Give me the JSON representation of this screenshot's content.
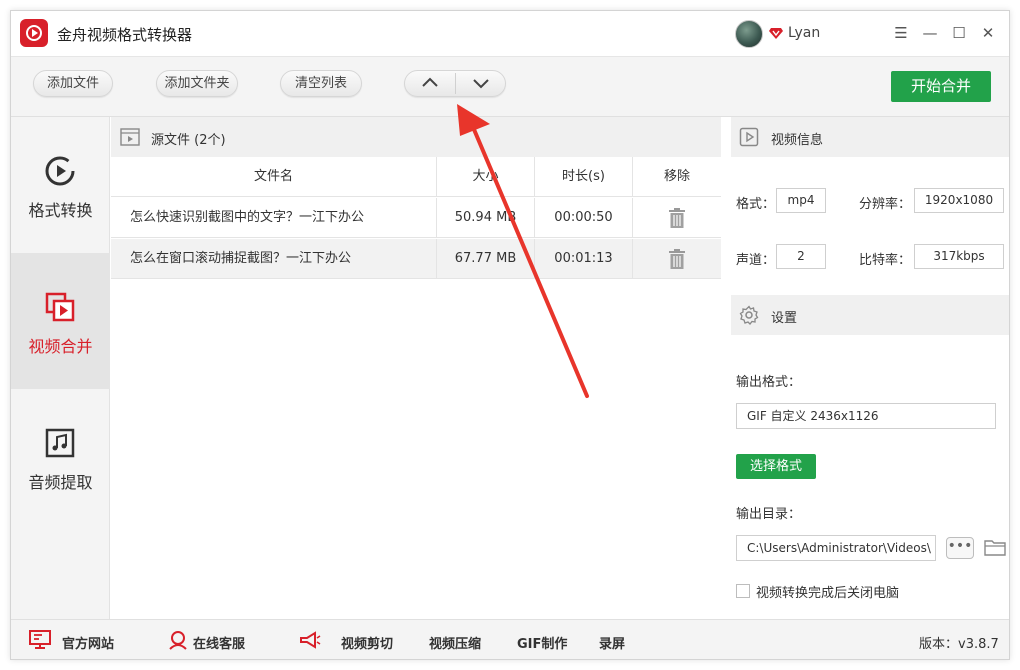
{
  "app": {
    "title": "金舟视频格式转换器"
  },
  "user": {
    "name": "Lyan"
  },
  "window_controls": {
    "menu": "☰",
    "minimize": "—",
    "maximize": "☐",
    "close": "✕"
  },
  "toolbar": {
    "add_file": "添加文件",
    "add_folder": "添加文件夹",
    "clear_list": "清空列表",
    "move_up_icon": "chevron-up-icon",
    "move_down_icon": "chevron-down-icon",
    "start_merge": "开始合并"
  },
  "sidebar": {
    "items": [
      {
        "label": "格式转换",
        "icon": "play-circle-icon",
        "active": false
      },
      {
        "label": "视频合并",
        "icon": "merge-icon",
        "active": true
      },
      {
        "label": "音频提取",
        "icon": "music-note-icon",
        "active": false
      }
    ]
  },
  "file_list": {
    "header": "源文件 (2个)",
    "columns": {
      "name": "文件名",
      "size": "大小",
      "duration": "时长(s)",
      "remove": "移除"
    },
    "rows": [
      {
        "name": "怎么快速识别截图中的文字？一江下办公",
        "size": "50.94 MB",
        "duration": "00:00:50"
      },
      {
        "name": "怎么在窗口滚动捕捉截图？一江下办公",
        "size": "67.77 MB",
        "duration": "00:01:13"
      }
    ]
  },
  "video_info": {
    "title": "视频信息",
    "format_label": "格式：",
    "format_value": "mp4",
    "resolution_label": "分辨率：",
    "resolution_value": "1920x1080",
    "channel_label": "声道：",
    "channel_value": "2",
    "bitrate_label": "比特率：",
    "bitrate_value": "317kbps"
  },
  "settings": {
    "title": "设置",
    "output_format_label": "输出格式：",
    "output_format_value": "GIF 自定义 2436x1126",
    "choose_format": "选择格式",
    "output_dir_label": "输出目录：",
    "output_dir_value": "C:\\Users\\Administrator\\Videos\\",
    "more_label": "•••",
    "shutdown_label": "视频转换完成后关闭电脑"
  },
  "bottom_bar": {
    "website": "官方网站",
    "support": "在线客服",
    "video_cut": "视频剪切",
    "video_compress": "视频压缩",
    "gif_make": "GIF制作",
    "record": "录屏",
    "version": "版本：v3.8.7"
  },
  "colors": {
    "accent_red": "#d8202a",
    "accent_green": "#22a24a",
    "annotation_red": "#e8352b"
  }
}
